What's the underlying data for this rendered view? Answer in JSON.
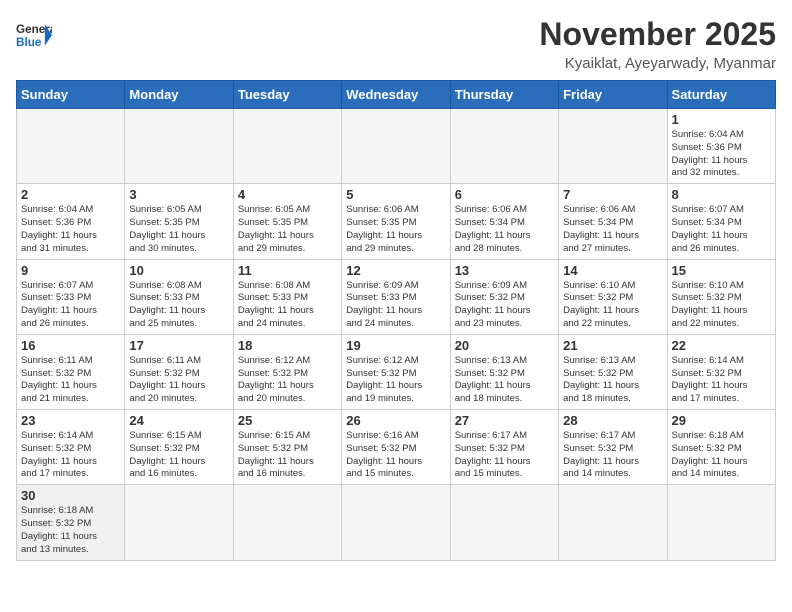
{
  "logo": {
    "text_general": "General",
    "text_blue": "Blue"
  },
  "header": {
    "month": "November 2025",
    "location": "Kyaiklat, Ayeyarwady, Myanmar"
  },
  "weekdays": [
    "Sunday",
    "Monday",
    "Tuesday",
    "Wednesday",
    "Thursday",
    "Friday",
    "Saturday"
  ],
  "weeks": [
    [
      {
        "day": "",
        "info": ""
      },
      {
        "day": "",
        "info": ""
      },
      {
        "day": "",
        "info": ""
      },
      {
        "day": "",
        "info": ""
      },
      {
        "day": "",
        "info": ""
      },
      {
        "day": "",
        "info": ""
      },
      {
        "day": "1",
        "info": "Sunrise: 6:04 AM\nSunset: 5:36 PM\nDaylight: 11 hours\nand 32 minutes."
      }
    ],
    [
      {
        "day": "2",
        "info": "Sunrise: 6:04 AM\nSunset: 5:36 PM\nDaylight: 11 hours\nand 31 minutes."
      },
      {
        "day": "3",
        "info": "Sunrise: 6:05 AM\nSunset: 5:35 PM\nDaylight: 11 hours\nand 30 minutes."
      },
      {
        "day": "4",
        "info": "Sunrise: 6:05 AM\nSunset: 5:35 PM\nDaylight: 11 hours\nand 29 minutes."
      },
      {
        "day": "5",
        "info": "Sunrise: 6:06 AM\nSunset: 5:35 PM\nDaylight: 11 hours\nand 29 minutes."
      },
      {
        "day": "6",
        "info": "Sunrise: 6:06 AM\nSunset: 5:34 PM\nDaylight: 11 hours\nand 28 minutes."
      },
      {
        "day": "7",
        "info": "Sunrise: 6:06 AM\nSunset: 5:34 PM\nDaylight: 11 hours\nand 27 minutes."
      },
      {
        "day": "8",
        "info": "Sunrise: 6:07 AM\nSunset: 5:34 PM\nDaylight: 11 hours\nand 26 minutes."
      }
    ],
    [
      {
        "day": "9",
        "info": "Sunrise: 6:07 AM\nSunset: 5:33 PM\nDaylight: 11 hours\nand 26 minutes."
      },
      {
        "day": "10",
        "info": "Sunrise: 6:08 AM\nSunset: 5:33 PM\nDaylight: 11 hours\nand 25 minutes."
      },
      {
        "day": "11",
        "info": "Sunrise: 6:08 AM\nSunset: 5:33 PM\nDaylight: 11 hours\nand 24 minutes."
      },
      {
        "day": "12",
        "info": "Sunrise: 6:09 AM\nSunset: 5:33 PM\nDaylight: 11 hours\nand 24 minutes."
      },
      {
        "day": "13",
        "info": "Sunrise: 6:09 AM\nSunset: 5:32 PM\nDaylight: 11 hours\nand 23 minutes."
      },
      {
        "day": "14",
        "info": "Sunrise: 6:10 AM\nSunset: 5:32 PM\nDaylight: 11 hours\nand 22 minutes."
      },
      {
        "day": "15",
        "info": "Sunrise: 6:10 AM\nSunset: 5:32 PM\nDaylight: 11 hours\nand 22 minutes."
      }
    ],
    [
      {
        "day": "16",
        "info": "Sunrise: 6:11 AM\nSunset: 5:32 PM\nDaylight: 11 hours\nand 21 minutes."
      },
      {
        "day": "17",
        "info": "Sunrise: 6:11 AM\nSunset: 5:32 PM\nDaylight: 11 hours\nand 20 minutes."
      },
      {
        "day": "18",
        "info": "Sunrise: 6:12 AM\nSunset: 5:32 PM\nDaylight: 11 hours\nand 20 minutes."
      },
      {
        "day": "19",
        "info": "Sunrise: 6:12 AM\nSunset: 5:32 PM\nDaylight: 11 hours\nand 19 minutes."
      },
      {
        "day": "20",
        "info": "Sunrise: 6:13 AM\nSunset: 5:32 PM\nDaylight: 11 hours\nand 18 minutes."
      },
      {
        "day": "21",
        "info": "Sunrise: 6:13 AM\nSunset: 5:32 PM\nDaylight: 11 hours\nand 18 minutes."
      },
      {
        "day": "22",
        "info": "Sunrise: 6:14 AM\nSunset: 5:32 PM\nDaylight: 11 hours\nand 17 minutes."
      }
    ],
    [
      {
        "day": "23",
        "info": "Sunrise: 6:14 AM\nSunset: 5:32 PM\nDaylight: 11 hours\nand 17 minutes."
      },
      {
        "day": "24",
        "info": "Sunrise: 6:15 AM\nSunset: 5:32 PM\nDaylight: 11 hours\nand 16 minutes."
      },
      {
        "day": "25",
        "info": "Sunrise: 6:15 AM\nSunset: 5:32 PM\nDaylight: 11 hours\nand 16 minutes."
      },
      {
        "day": "26",
        "info": "Sunrise: 6:16 AM\nSunset: 5:32 PM\nDaylight: 11 hours\nand 15 minutes."
      },
      {
        "day": "27",
        "info": "Sunrise: 6:17 AM\nSunset: 5:32 PM\nDaylight: 11 hours\nand 15 minutes."
      },
      {
        "day": "28",
        "info": "Sunrise: 6:17 AM\nSunset: 5:32 PM\nDaylight: 11 hours\nand 14 minutes."
      },
      {
        "day": "29",
        "info": "Sunrise: 6:18 AM\nSunset: 5:32 PM\nDaylight: 11 hours\nand 14 minutes."
      }
    ],
    [
      {
        "day": "30",
        "info": "Sunrise: 6:18 AM\nSunset: 5:32 PM\nDaylight: 11 hours\nand 13 minutes."
      },
      {
        "day": "",
        "info": ""
      },
      {
        "day": "",
        "info": ""
      },
      {
        "day": "",
        "info": ""
      },
      {
        "day": "",
        "info": ""
      },
      {
        "day": "",
        "info": ""
      },
      {
        "day": "",
        "info": ""
      }
    ]
  ]
}
